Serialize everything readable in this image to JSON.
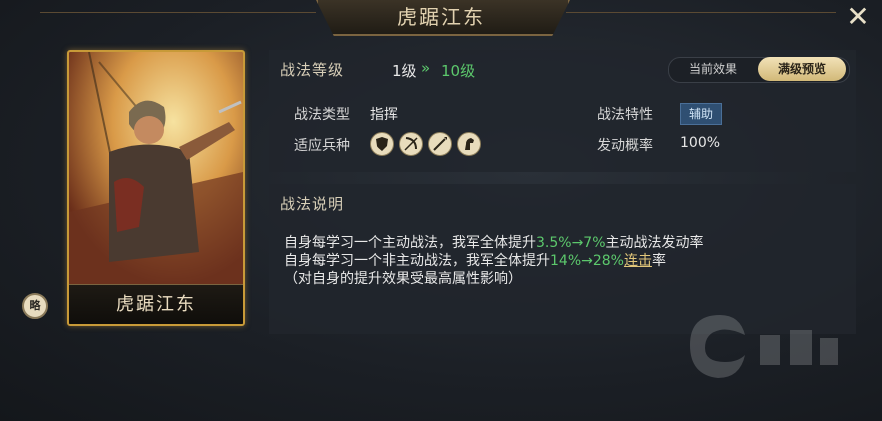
{
  "header": {
    "title": "虎踞江东",
    "close_symbol": "✕"
  },
  "card": {
    "name": "虎踞江东",
    "badge": "略"
  },
  "level": {
    "label": "战法等级",
    "current": "1级",
    "arrow": "»",
    "max": "10级"
  },
  "toggle": {
    "current_label": "当前效果",
    "max_label": "满级预览",
    "selected": "满级预览"
  },
  "attributes": {
    "type_label": "战法类型",
    "type_value": "指挥",
    "trait_label": "战法特性",
    "trait_value": "辅助",
    "troops_label": "适应兵种",
    "rate_label": "发动概率",
    "rate_value": "100%"
  },
  "troop_icons": [
    "shield-icon",
    "bow-icon",
    "spear-icon",
    "horse-icon"
  ],
  "description": {
    "heading": "战法说明",
    "line1_a": "自身每学习一个主动战法，我军全体提升",
    "line1_val": "3.5%→7%",
    "line1_b": "主动战法发动率",
    "line2_a": "自身每学习一个非主动战法，我军全体提升",
    "line2_val": "14%→28%",
    "line2_link": "连击",
    "line2_b": "率",
    "line3": "（对自身的提升效果受最高属性影响）"
  },
  "colors": {
    "accent_gold": "#c89a38",
    "value_green": "#5cc86c",
    "tag_blue": "#2f4f72"
  }
}
